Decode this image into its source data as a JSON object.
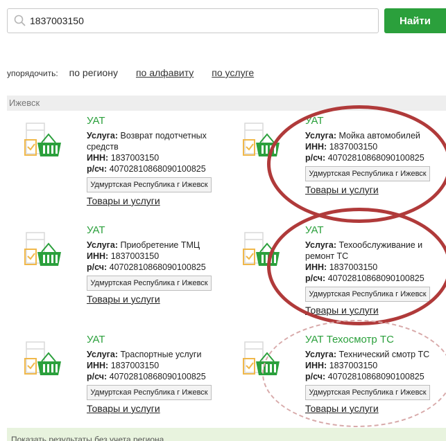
{
  "search": {
    "value": "1837003150",
    "button_label": "Найти"
  },
  "sort": {
    "label": "упорядочить:",
    "options": [
      "по региону",
      "по алфавиту",
      "по услуге"
    ]
  },
  "region_header": "Ижевск",
  "cards": [
    {
      "title": "УАТ",
      "service_label": "Услуга:",
      "service": "Возврат подотчетных средств",
      "inn_label": "ИНН:",
      "inn": "1837003150",
      "account_label": "р/сч:",
      "account": "40702810868090100825",
      "region_button": "Удмуртская Республика г Ижевск",
      "link": "Товары и услуги"
    },
    {
      "title": "УАТ",
      "service_label": "Услуга:",
      "service": "Мойка автомобилей",
      "inn_label": "ИНН:",
      "inn": "1837003150",
      "account_label": "р/сч:",
      "account": "40702810868090100825",
      "region_button": "Удмуртская Республика г Ижевск",
      "link": "Товары и услуги"
    },
    {
      "title": "УАТ",
      "service_label": "Услуга:",
      "service": "Приобретение ТМЦ",
      "inn_label": "ИНН:",
      "inn": "1837003150",
      "account_label": "р/сч:",
      "account": "40702810868090100825",
      "region_button": "Удмуртская Республика г Ижевск",
      "link": "Товары и услуги"
    },
    {
      "title": "УАТ",
      "service_label": "Услуга:",
      "service": "Техообслуживание и ремонт ТС",
      "inn_label": "ИНН:",
      "inn": "1837003150",
      "account_label": "р/сч:",
      "account": "40702810868090100825",
      "region_button": "Удмуртская Республика г Ижевск",
      "link": "Товары и услуги"
    },
    {
      "title": "УАТ",
      "service_label": "Услуга:",
      "service": "Траспортные услуги",
      "inn_label": "ИНН:",
      "inn": "1837003150",
      "account_label": "р/сч:",
      "account": "40702810868090100825",
      "region_button": "Удмуртская Республика г Ижевск",
      "link": "Товары и услуги"
    },
    {
      "title": "УАТ Техосмотр ТС",
      "service_label": "Услуга:",
      "service": "Технический смотр ТС",
      "inn_label": "ИНН:",
      "inn": "1837003150",
      "account_label": "р/сч:",
      "account": "40702810868090100825",
      "region_button": "Удмуртская Республика г Ижевск",
      "link": "Товары и услуги"
    }
  ],
  "footer_text": "Показать результаты без учета региона",
  "colors": {
    "accent": "#2ba03c",
    "annotation": "#b03a3a",
    "icon_orange": "#f0b84a"
  }
}
